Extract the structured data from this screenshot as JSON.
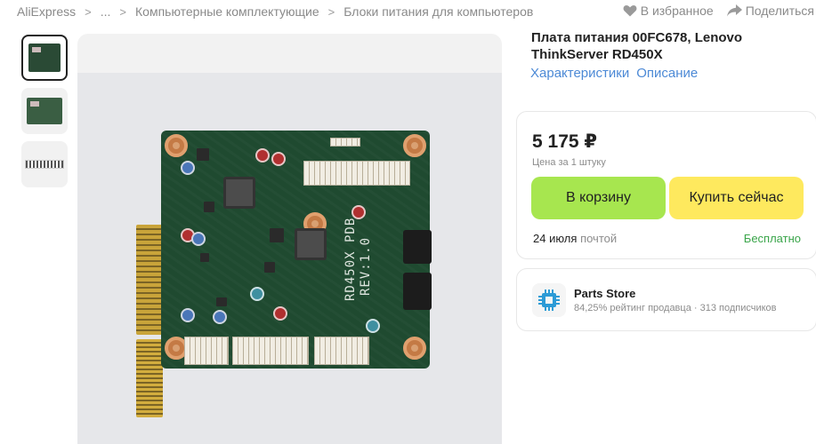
{
  "breadcrumb": {
    "items": [
      "AliExpress",
      "...",
      "Компьютерные комплектующие",
      "Блоки питания для компьютеров"
    ],
    "separator": ">"
  },
  "top_actions": {
    "favorite_label": "В избранное",
    "share_label": "Поделиться",
    "favorite_icon": "heart-icon",
    "share_icon": "share-arrow-icon"
  },
  "gallery": {
    "thumbnail_count": 3,
    "active_thumbnail": 1
  },
  "product": {
    "title": "Плата питания 00FC678, Lenovo ThinkServer RD450X",
    "tabs": [
      "Характеристики",
      "Описание"
    ],
    "board_silkscreen": [
      "RD450X PDB",
      "REV:1.0"
    ]
  },
  "purchase": {
    "price": "5 175 ₽",
    "price_note": "Цена за 1 штуку",
    "cart_button": "В корзину",
    "buy_button": "Купить сейчас",
    "delivery_date": "24 июля",
    "delivery_method": "почтой",
    "delivery_cost": "Бесплатно"
  },
  "store": {
    "name": "Parts Store",
    "meta": "84,25% рейтинг продавца · 313 подписчиков"
  },
  "colors": {
    "accent_link": "#4d8ad6",
    "cart_button": "#a7e64f",
    "buy_button": "#fee95e",
    "free_delivery": "#3aa54a"
  }
}
